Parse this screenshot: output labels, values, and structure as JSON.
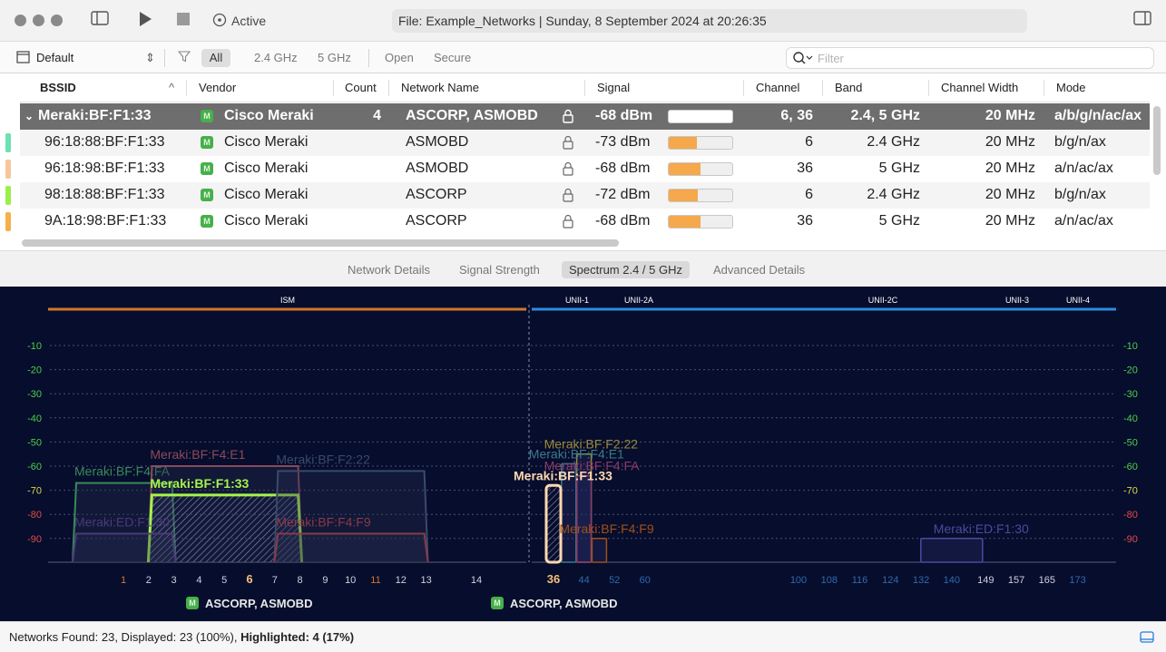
{
  "toolbar": {
    "status": "Active",
    "file_info": "File: Example_Networks | Sunday, 8 September 2024 at 20:26:35"
  },
  "filterbar": {
    "profile": "Default",
    "filters": [
      "All",
      "2.4 GHz",
      "5 GHz",
      "Open",
      "Secure"
    ],
    "selected_filter": "All",
    "search_placeholder": "Filter"
  },
  "table": {
    "headers": [
      "BSSID",
      "Vendor",
      "Count",
      "Network Name",
      "Signal",
      "Channel",
      "Band",
      "Channel Width",
      "Mode"
    ],
    "parent_row": {
      "bssid": "Meraki:BF:F1:33",
      "vendor": "Cisco Meraki",
      "count": "4",
      "network": "ASCORP, ASMOBD",
      "signal": "-68 dBm",
      "signal_fraction": 0.5,
      "channel": "6, 36",
      "band": "2.4, 5 GHz",
      "width": "20 MHz",
      "mode": "a/b/g/n/ac/ax"
    },
    "rows": [
      {
        "color": "#6de0b4",
        "bssid": "96:18:88:BF:F1:33",
        "vendor": "Cisco Meraki",
        "network": "ASMOBD",
        "signal": "-73 dBm",
        "signal_fraction": 0.44,
        "channel": "6",
        "band": "2.4 GHz",
        "width": "20 MHz",
        "mode": "b/g/n/ax"
      },
      {
        "color": "#f7c69a",
        "bssid": "96:18:98:BF:F1:33",
        "vendor": "Cisco Meraki",
        "network": "ASMOBD",
        "signal": "-68 dBm",
        "signal_fraction": 0.5,
        "channel": "36",
        "band": "5 GHz",
        "width": "20 MHz",
        "mode": "a/n/ac/ax"
      },
      {
        "color": "#9af04a",
        "bssid": "98:18:88:BF:F1:33",
        "vendor": "Cisco Meraki",
        "network": "ASCORP",
        "signal": "-72 dBm",
        "signal_fraction": 0.45,
        "channel": "6",
        "band": "2.4 GHz",
        "width": "20 MHz",
        "mode": "b/g/n/ax"
      },
      {
        "color": "#f5b04a",
        "bssid": "9A:18:98:BF:F1:33",
        "vendor": "Cisco Meraki",
        "network": "ASCORP",
        "signal": "-68 dBm",
        "signal_fraction": 0.5,
        "channel": "36",
        "band": "5 GHz",
        "width": "20 MHz",
        "mode": "a/n/ac/ax"
      }
    ]
  },
  "tabs": [
    "Network Details",
    "Signal Strength",
    "Spectrum 2.4 / 5 GHz",
    "Advanced Details"
  ],
  "selected_tab": "Spectrum 2.4 / 5 GHz",
  "chart_data": {
    "type": "area",
    "bands": [
      "ISM",
      "UNII-1",
      "UNII-2A",
      "UNII-2C",
      "UNII-3",
      "UNII-4"
    ],
    "y_ticks": [
      -10,
      -20,
      -30,
      -40,
      -50,
      -60,
      -70,
      -80,
      -90
    ],
    "ylim": [
      -100,
      -5
    ],
    "x_24ghz_ticks": [
      "1",
      "2",
      "3",
      "4",
      "5",
      "6",
      "7",
      "8",
      "9",
      "10",
      "11",
      "12",
      "13",
      "14"
    ],
    "x_5ghz_ticks": [
      "36",
      "44",
      "52",
      "60",
      "100",
      "108",
      "116",
      "124",
      "132",
      "140",
      "149",
      "157",
      "165",
      "173"
    ],
    "highlighted_channels": [
      "6",
      "36"
    ],
    "networks_24ghz": [
      {
        "label": "Meraki:BF:F4:FA",
        "channel_from": 1,
        "channel_to": 3,
        "signal": -67,
        "color": "#3a8a5a"
      },
      {
        "label": "Meraki:BF:F4:E1",
        "channel_from": 4,
        "channel_to": 8,
        "signal": -60,
        "color": "#8a4a5a"
      },
      {
        "label": "Meraki:BF:F1:33",
        "channel_from": 4,
        "channel_to": 8,
        "signal": -72,
        "color": "#a6f24a"
      },
      {
        "label": "Meraki:BF:F2:22",
        "channel_from": 9,
        "channel_to": 13,
        "signal": -62,
        "color": "#3a4a6a"
      },
      {
        "label": "Meraki:ED:F1:30",
        "channel_from": 1,
        "channel_to": 3,
        "signal": -88,
        "color": "#4a3a7a"
      },
      {
        "label": "Meraki:BF:F4:F9",
        "channel_from": 9,
        "channel_to": 13,
        "signal": -88,
        "color": "#8a3a4a"
      }
    ],
    "networks_5ghz": [
      {
        "label": "Meraki:BF:F2:22",
        "channel": 44,
        "signal": -55,
        "color": "#9a8a3a"
      },
      {
        "label": "Meraki:BF:F4:E1",
        "channel": 40,
        "signal": -59,
        "color": "#3a7a8a"
      },
      {
        "label": "Meraki:BF:F4:FA",
        "channel": 44,
        "signal": -64,
        "color": "#8a3a6a"
      },
      {
        "label": "Meraki:BF:F1:33",
        "channel": 36,
        "signal": -68,
        "color": "#ffd8b0"
      },
      {
        "label": "Meraki:BF:F4:F9",
        "channel": 48,
        "signal": -90,
        "color": "#a0501a"
      },
      {
        "label": "Meraki:ED:F1:30",
        "channel": 140,
        "signal": -90,
        "color": "#4a4aa0"
      }
    ],
    "legend_24ghz": "ASCORP, ASMOBD",
    "legend_5ghz": "ASCORP, ASMOBD"
  },
  "status": {
    "text": "Networks Found: 23, Displayed: 23 (100%), ",
    "highlighted": "Highlighted: 4 (17%)"
  }
}
